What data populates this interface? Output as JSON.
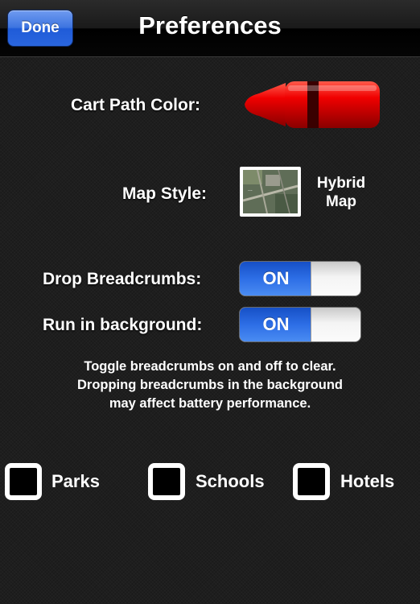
{
  "navbar": {
    "done_label": "Done",
    "title": "Preferences"
  },
  "cart_path": {
    "label": "Cart Path Color:",
    "color": "#e00000"
  },
  "map_style": {
    "label": "Map Style:",
    "thumbnail_text": "...",
    "value_line1": "Hybrid",
    "value_line2": "Map"
  },
  "breadcrumbs": {
    "label": "Drop Breadcrumbs:",
    "state": "ON"
  },
  "background": {
    "label": "Run in background:",
    "state": "ON"
  },
  "info": {
    "line1": "Toggle breadcrumbs on and off to clear.",
    "line2": "Dropping breadcrumbs in the background",
    "line3": "may affect battery performance."
  },
  "filters": [
    {
      "label": "Parks",
      "checked": false
    },
    {
      "label": "Schools",
      "checked": false
    },
    {
      "label": "Hotels",
      "checked": false
    }
  ],
  "colors": {
    "toggle_on": "#2d6ee6",
    "done_button": "#3d74e0"
  }
}
